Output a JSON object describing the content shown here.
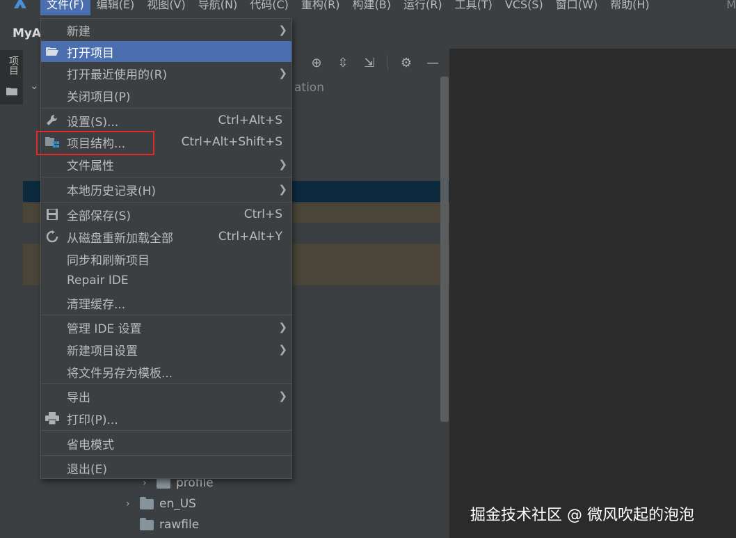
{
  "menubar": {
    "items": [
      "文件(F)",
      "编辑(E)",
      "视图(V)",
      "导航(N)",
      "代码(C)",
      "重构(R)",
      "构建(B)",
      "运行(R)",
      "工具(T)",
      "VCS(S)",
      "窗口(W)",
      "帮助(H)"
    ],
    "title_partial": "M"
  },
  "titlebar": {
    "project_name": "MyA"
  },
  "toolstrip": {
    "project_tab_label": "项目"
  },
  "project_panel": {
    "partial_text": "ation",
    "tree": [
      {
        "label": "profile",
        "icon": "folder-icon"
      },
      {
        "label": "en_US",
        "icon": "folder-icon"
      },
      {
        "label": "rawfile",
        "icon": "folder-icon"
      }
    ]
  },
  "file_menu": {
    "items": [
      {
        "label": "新建",
        "shortcut": "",
        "submenu": true,
        "icon": ""
      },
      {
        "label": "打开项目",
        "shortcut": "",
        "submenu": false,
        "icon": "folder-open-icon",
        "selected": true
      },
      {
        "label": "打开最近使用的(R)",
        "shortcut": "",
        "submenu": true,
        "icon": ""
      },
      {
        "label": "关闭项目(P)",
        "shortcut": "",
        "submenu": false,
        "icon": ""
      },
      {
        "label": "设置(S)...",
        "shortcut": "Ctrl+Alt+S",
        "submenu": false,
        "icon": "wrench-icon"
      },
      {
        "label": "项目结构...",
        "shortcut": "Ctrl+Alt+Shift+S",
        "submenu": false,
        "icon": "project-structure-icon"
      },
      {
        "label": "文件属性",
        "shortcut": "",
        "submenu": true,
        "icon": ""
      },
      {
        "label": "本地历史记录(H)",
        "shortcut": "",
        "submenu": true,
        "icon": ""
      },
      {
        "label": "全部保存(S)",
        "shortcut": "Ctrl+S",
        "submenu": false,
        "icon": "save-icon"
      },
      {
        "label": "从磁盘重新加载全部",
        "shortcut": "Ctrl+Alt+Y",
        "submenu": false,
        "icon": "reload-icon"
      },
      {
        "label": "同步和刷新项目",
        "shortcut": "",
        "submenu": false,
        "icon": ""
      },
      {
        "label": "Repair IDE",
        "shortcut": "",
        "submenu": false,
        "icon": ""
      },
      {
        "label": "清理缓存...",
        "shortcut": "",
        "submenu": false,
        "icon": ""
      },
      {
        "label": "管理 IDE 设置",
        "shortcut": "",
        "submenu": true,
        "icon": ""
      },
      {
        "label": "新建项目设置",
        "shortcut": "",
        "submenu": true,
        "icon": ""
      },
      {
        "label": "将文件另存为模板...",
        "shortcut": "",
        "submenu": false,
        "icon": ""
      },
      {
        "label": "导出",
        "shortcut": "",
        "submenu": true,
        "icon": ""
      },
      {
        "label": "打印(P)...",
        "shortcut": "",
        "submenu": false,
        "icon": "print-icon"
      },
      {
        "label": "省电模式",
        "shortcut": "",
        "submenu": false,
        "icon": ""
      },
      {
        "label": "退出(E)",
        "shortcut": "",
        "submenu": false,
        "icon": ""
      }
    ]
  },
  "watermark": "掘金技术社区 @ 微风吹起的泡泡",
  "colors": {
    "selection": "#4b6eaf",
    "highlight_box": "#e02b2b",
    "menu_bg": "#3c3f41"
  }
}
